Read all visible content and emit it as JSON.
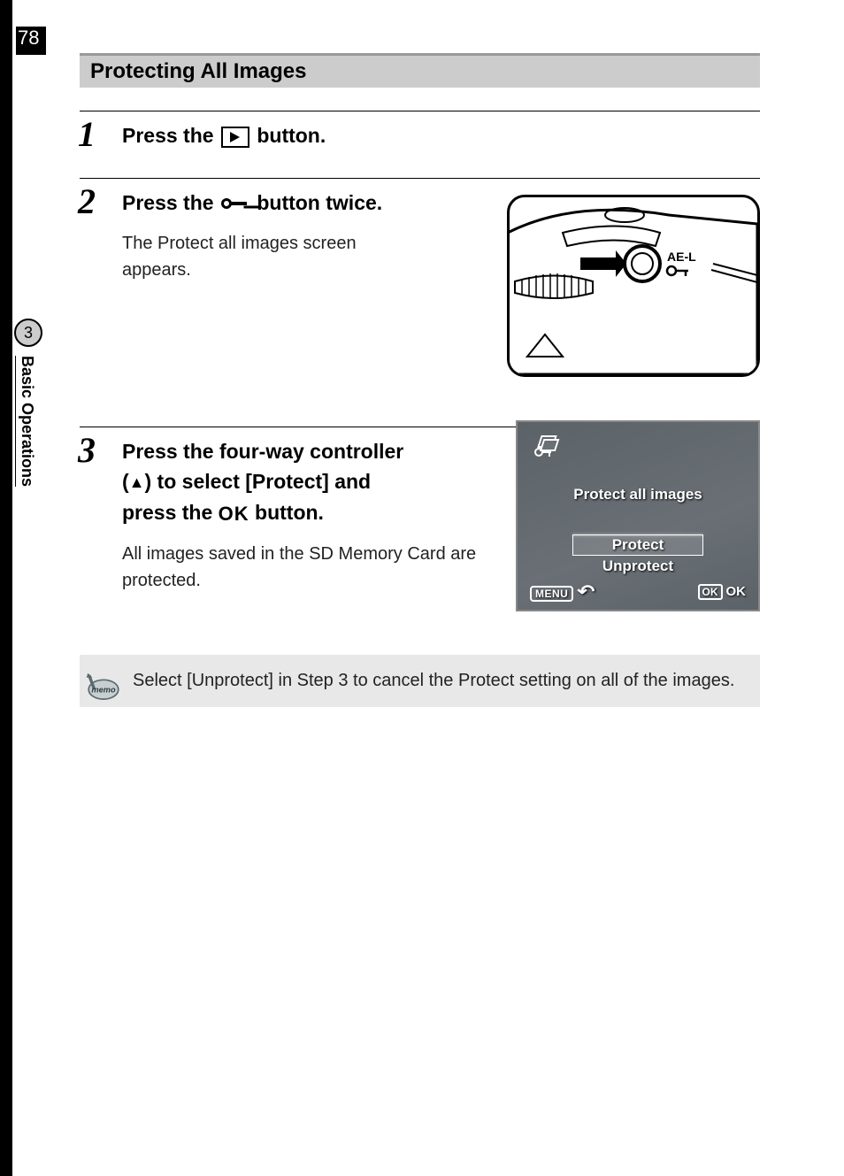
{
  "page_number": "78",
  "side_tab": {
    "chapter_num": "3",
    "chapter_title": "Basic Operations"
  },
  "section_title": "Protecting All Images",
  "steps": {
    "s1": {
      "num": "1",
      "h_pre": "Press the ",
      "h_post": " button."
    },
    "s2": {
      "num": "2",
      "h_pre": "Press the ",
      "h_post": " button twice.",
      "body": "The Protect all images screen appears."
    },
    "s3": {
      "num": "3",
      "h_line1a": "Press the four-way controller ",
      "h_line2a": "(",
      "h_line2b": ") to select [Protect] and ",
      "h_line3a": "press the ",
      "h_line3b": " button.",
      "body": "All images saved in the SD Memory Card are protected."
    }
  },
  "camera_label": {
    "ael": "AE-L"
  },
  "lcd": {
    "title": "Protect all images",
    "option1": "Protect",
    "option2": "Unprotect",
    "menu": "MENU",
    "ok_box": "OK",
    "ok_text": "OK"
  },
  "memo": {
    "label": "memo",
    "text": "Select [Unprotect] in Step 3 to cancel the Protect setting on all of the images."
  },
  "icons": {
    "up_triangle": "▲",
    "ok": "OK"
  }
}
